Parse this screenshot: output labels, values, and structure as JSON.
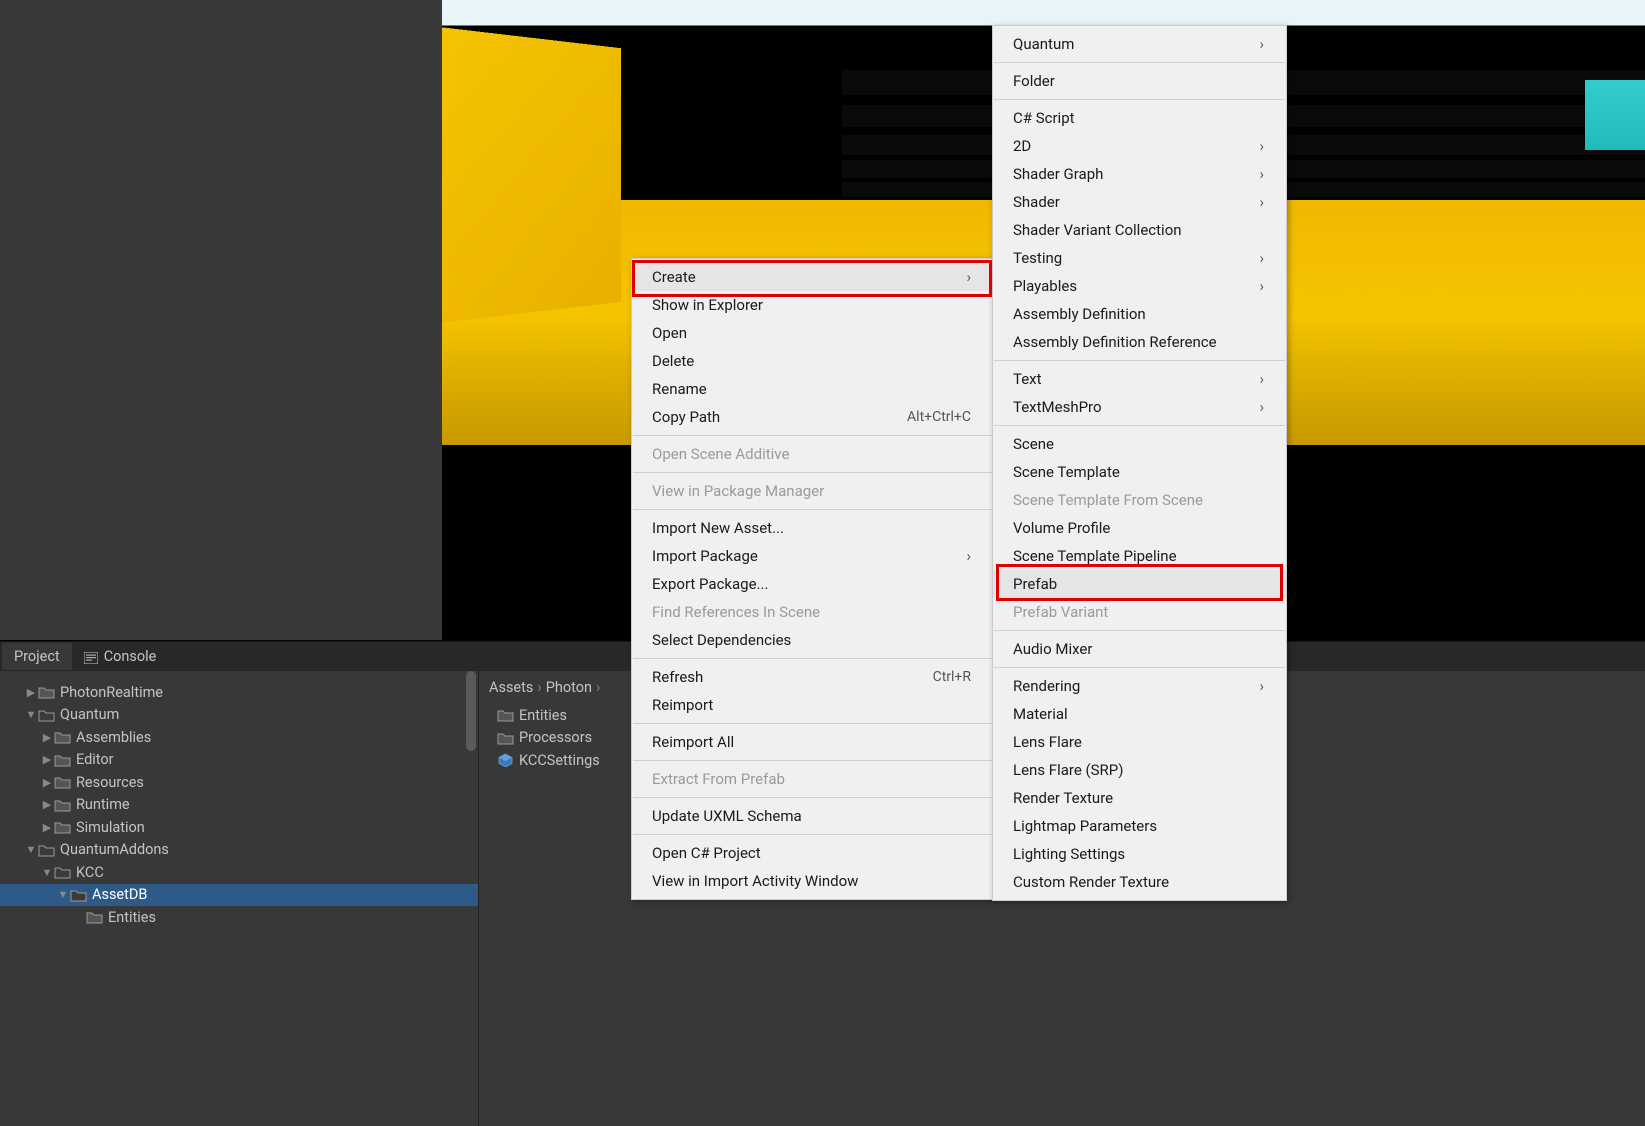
{
  "tabs": {
    "project": "Project",
    "console": "Console"
  },
  "tree": [
    {
      "label": "PhotonRealtime",
      "depth": 1,
      "arrow": "right",
      "sel": false
    },
    {
      "label": "Quantum",
      "depth": 1,
      "arrow": "down",
      "sel": false
    },
    {
      "label": "Assemblies",
      "depth": 2,
      "arrow": "right",
      "sel": false
    },
    {
      "label": "Editor",
      "depth": 2,
      "arrow": "right",
      "sel": false
    },
    {
      "label": "Resources",
      "depth": 2,
      "arrow": "right",
      "sel": false
    },
    {
      "label": "Runtime",
      "depth": 2,
      "arrow": "right",
      "sel": false
    },
    {
      "label": "Simulation",
      "depth": 2,
      "arrow": "right",
      "sel": false
    },
    {
      "label": "QuantumAddons",
      "depth": 1,
      "arrow": "down",
      "sel": false
    },
    {
      "label": "KCC",
      "depth": 2,
      "arrow": "down",
      "sel": false
    },
    {
      "label": "AssetDB",
      "depth": 3,
      "arrow": "down",
      "sel": true
    },
    {
      "label": "Entities",
      "depth": 4,
      "arrow": "none",
      "sel": false
    }
  ],
  "breadcrumb": [
    "Assets",
    "Photon"
  ],
  "files": [
    {
      "label": "Entities",
      "type": "folder"
    },
    {
      "label": "Processors",
      "type": "folder"
    },
    {
      "label": "KCCSettings",
      "type": "prefab"
    }
  ],
  "ctx1": [
    {
      "t": "item",
      "label": "Create",
      "sub": true,
      "disabled": false,
      "hov": true
    },
    {
      "t": "item",
      "label": "Show in Explorer"
    },
    {
      "t": "item",
      "label": "Open"
    },
    {
      "t": "item",
      "label": "Delete"
    },
    {
      "t": "item",
      "label": "Rename"
    },
    {
      "t": "item",
      "label": "Copy Path",
      "shortcut": "Alt+Ctrl+C"
    },
    {
      "t": "sep"
    },
    {
      "t": "item",
      "label": "Open Scene Additive",
      "disabled": true
    },
    {
      "t": "sep"
    },
    {
      "t": "item",
      "label": "View in Package Manager",
      "disabled": true
    },
    {
      "t": "sep"
    },
    {
      "t": "item",
      "label": "Import New Asset..."
    },
    {
      "t": "item",
      "label": "Import Package",
      "sub": true
    },
    {
      "t": "item",
      "label": "Export Package..."
    },
    {
      "t": "item",
      "label": "Find References In Scene",
      "disabled": true
    },
    {
      "t": "item",
      "label": "Select Dependencies"
    },
    {
      "t": "sep"
    },
    {
      "t": "item",
      "label": "Refresh",
      "shortcut": "Ctrl+R"
    },
    {
      "t": "item",
      "label": "Reimport"
    },
    {
      "t": "sep"
    },
    {
      "t": "item",
      "label": "Reimport All"
    },
    {
      "t": "sep"
    },
    {
      "t": "item",
      "label": "Extract From Prefab",
      "disabled": true
    },
    {
      "t": "sep"
    },
    {
      "t": "item",
      "label": "Update UXML Schema"
    },
    {
      "t": "sep"
    },
    {
      "t": "item",
      "label": "Open C# Project"
    },
    {
      "t": "item",
      "label": "View in Import Activity Window"
    }
  ],
  "ctx2": [
    {
      "t": "item",
      "label": "Quantum",
      "sub": true
    },
    {
      "t": "sep"
    },
    {
      "t": "item",
      "label": "Folder"
    },
    {
      "t": "sep"
    },
    {
      "t": "item",
      "label": "C# Script"
    },
    {
      "t": "item",
      "label": "2D",
      "sub": true
    },
    {
      "t": "item",
      "label": "Shader Graph",
      "sub": true
    },
    {
      "t": "item",
      "label": "Shader",
      "sub": true
    },
    {
      "t": "item",
      "label": "Shader Variant Collection"
    },
    {
      "t": "item",
      "label": "Testing",
      "sub": true
    },
    {
      "t": "item",
      "label": "Playables",
      "sub": true
    },
    {
      "t": "item",
      "label": "Assembly Definition"
    },
    {
      "t": "item",
      "label": "Assembly Definition Reference"
    },
    {
      "t": "sep"
    },
    {
      "t": "item",
      "label": "Text",
      "sub": true
    },
    {
      "t": "item",
      "label": "TextMeshPro",
      "sub": true
    },
    {
      "t": "sep"
    },
    {
      "t": "item",
      "label": "Scene"
    },
    {
      "t": "item",
      "label": "Scene Template"
    },
    {
      "t": "item",
      "label": "Scene Template From Scene",
      "disabled": true
    },
    {
      "t": "item",
      "label": "Volume Profile"
    },
    {
      "t": "item",
      "label": "Scene Template Pipeline"
    },
    {
      "t": "item",
      "label": "Prefab",
      "hov": true
    },
    {
      "t": "item",
      "label": "Prefab Variant",
      "disabled": true
    },
    {
      "t": "sep"
    },
    {
      "t": "item",
      "label": "Audio Mixer"
    },
    {
      "t": "sep"
    },
    {
      "t": "item",
      "label": "Rendering",
      "sub": true
    },
    {
      "t": "item",
      "label": "Material"
    },
    {
      "t": "item",
      "label": "Lens Flare"
    },
    {
      "t": "item",
      "label": "Lens Flare (SRP)"
    },
    {
      "t": "item",
      "label": "Render Texture"
    },
    {
      "t": "item",
      "label": "Lightmap Parameters"
    },
    {
      "t": "item",
      "label": "Lighting Settings"
    },
    {
      "t": "item",
      "label": "Custom Render Texture"
    }
  ]
}
